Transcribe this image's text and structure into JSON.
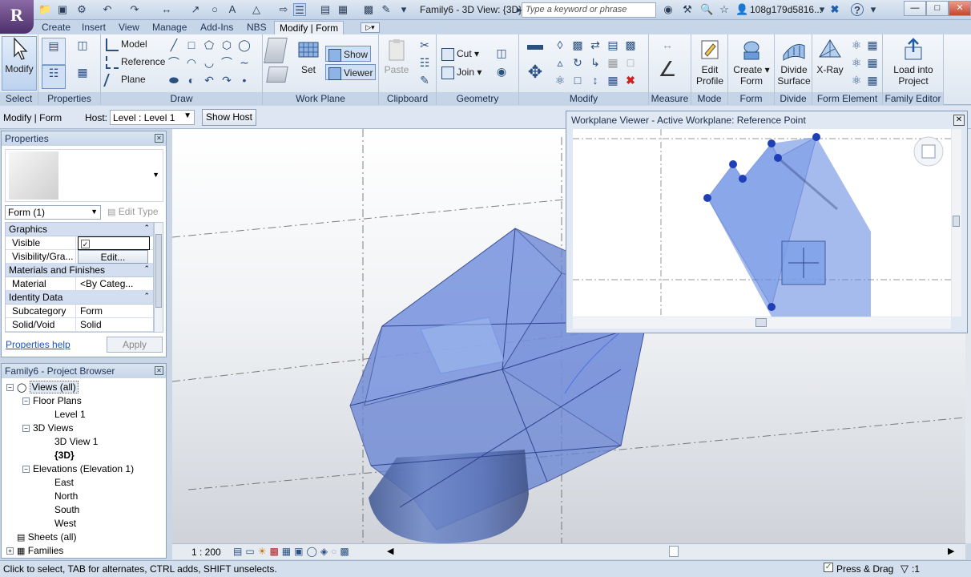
{
  "titlebar": {
    "app_letter": "R",
    "document_title": "Family6 - 3D View: {3D}",
    "search_placeholder": "Type a keyword or phrase",
    "user": "108g179d5816...",
    "help": "?"
  },
  "tabs": [
    "Create",
    "Insert",
    "View",
    "Manage",
    "Add-Ins",
    "NBS",
    "Modify | Form"
  ],
  "ribbon": {
    "select": {
      "button": "Modify",
      "label": "Select"
    },
    "properties": {
      "label": "Properties"
    },
    "draw": {
      "model": "Model",
      "reference": "Reference",
      "plane": "Plane",
      "label": "Draw"
    },
    "work_plane": {
      "set": "Set",
      "show": "Show",
      "viewer": "Viewer",
      "label": "Work Plane"
    },
    "clipboard": {
      "paste": "Paste",
      "label": "Clipboard"
    },
    "geometry": {
      "cut": "Cut",
      "join": "Join",
      "label": "Geometry"
    },
    "modify": {
      "label": "Modify"
    },
    "measure": {
      "label": "Measure"
    },
    "mode": {
      "button_line1": "Edit",
      "button_line2": "Profile",
      "label": "Mode"
    },
    "form": {
      "button_line1": "Create",
      "button_line2": "Form",
      "label": "Form"
    },
    "divide": {
      "button_line1": "Divide",
      "button_line2": "Surface",
      "label": "Divide"
    },
    "form_element": {
      "button": "X-Ray",
      "label": "Form Element"
    },
    "family_editor": {
      "button_line1": "Load into",
      "button_line2": "Project",
      "label": "Family Editor"
    }
  },
  "options_bar": {
    "context": "Modify | Form",
    "host_label": "Host:",
    "host_value": "Level : Level 1",
    "show_host": "Show Host"
  },
  "properties": {
    "title": "Properties",
    "type_selector": "Form (1)",
    "edit_type": "Edit Type",
    "groups": [
      {
        "name": "Graphics",
        "rows": [
          {
            "key": "Visible",
            "value": "✓"
          },
          {
            "key": "Visibility/Gra...",
            "value": "Edit..."
          }
        ]
      },
      {
        "name": "Materials and Finishes",
        "rows": [
          {
            "key": "Material",
            "value": "<By Categ..."
          }
        ]
      },
      {
        "name": "Identity Data",
        "rows": [
          {
            "key": "Subcategory",
            "value": "Form"
          },
          {
            "key": "Solid/Void",
            "value": "Solid"
          }
        ]
      }
    ],
    "help_link": "Properties help",
    "apply": "Apply"
  },
  "project_browser": {
    "title": "Family6 - Project Browser",
    "items": [
      {
        "label": "Views (all)",
        "level": 0
      },
      {
        "label": "Floor Plans",
        "level": 1
      },
      {
        "label": "Level 1",
        "level": 2
      },
      {
        "label": "3D Views",
        "level": 1
      },
      {
        "label": "3D View 1",
        "level": 2
      },
      {
        "label": "{3D}",
        "level": 2
      },
      {
        "label": "Elevations (Elevation 1)",
        "level": 1
      },
      {
        "label": "East",
        "level": 2
      },
      {
        "label": "North",
        "level": 2
      },
      {
        "label": "South",
        "level": 2
      },
      {
        "label": "West",
        "level": 2
      },
      {
        "label": "Sheets (all)",
        "level": 0
      },
      {
        "label": "Families",
        "level": 0
      }
    ]
  },
  "workplane_viewer": {
    "title": "Workplane Viewer - Active Workplane: Reference Point"
  },
  "view_control_bar": {
    "scale": "1 : 200"
  },
  "status_bar": {
    "message": "Click to select, TAB for alternates, CTRL adds, SHIFT unselects.",
    "press_drag": "Press & Drag",
    "filter_count": ":1"
  },
  "colors": {
    "form_blue": "#5b84e0",
    "ribbon_label": "#c6d4e7",
    "selection_dot": "#1e3fb5"
  }
}
